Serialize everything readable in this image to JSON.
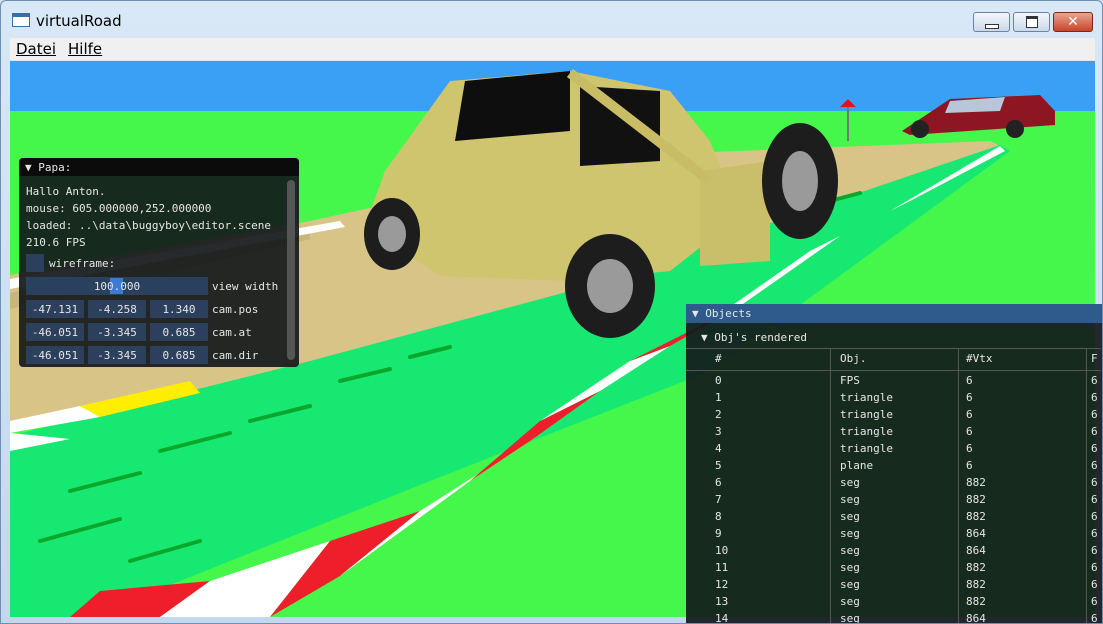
{
  "window": {
    "title": "virtualRoad",
    "minimize_icon": "minimize-icon",
    "maximize_icon": "maximize-icon",
    "close_icon": "close-icon",
    "close_glyph": "✕"
  },
  "menu": {
    "items": [
      "Datei",
      "Hilfe"
    ]
  },
  "papa": {
    "title": "▼ Papa:",
    "greeting": "Hallo Anton.",
    "mouse": "mouse: 605.000000,252.000000",
    "loaded": "loaded: ..\\data\\buggyboy\\editor.scene",
    "fps": "210.6 FPS",
    "wireframe_label": "wireframe:",
    "view_width_value": "100.000",
    "view_width_label": "view width",
    "cam_pos": [
      "-47.131",
      "-4.258",
      "1.340"
    ],
    "cam_pos_label": "cam.pos",
    "cam_at": [
      "-46.051",
      "-3.345",
      "0.685"
    ],
    "cam_at_label": "cam.at",
    "cam_dir": [
      "-46.051",
      "-3.345",
      "0.685"
    ],
    "cam_dir_label": "cam.dir"
  },
  "objects": {
    "title": "▼ Objects",
    "subheader": "▼ Obj's rendered",
    "columns": [
      "#",
      "Obj.",
      "#Vtx",
      "F"
    ],
    "rows": [
      [
        "0",
        "FPS",
        "6",
        "6"
      ],
      [
        "1",
        "triangle",
        "6",
        "6"
      ],
      [
        "2",
        "triangle",
        "6",
        "6"
      ],
      [
        "3",
        "triangle",
        "6",
        "6"
      ],
      [
        "4",
        "triangle",
        "6",
        "6"
      ],
      [
        "5",
        "plane",
        "6",
        "6"
      ],
      [
        "6",
        "seg",
        "882",
        "6"
      ],
      [
        "7",
        "seg",
        "882",
        "6"
      ],
      [
        "8",
        "seg",
        "882",
        "6"
      ],
      [
        "9",
        "seg",
        "864",
        "6"
      ],
      [
        "10",
        "seg",
        "864",
        "6"
      ],
      [
        "11",
        "seg",
        "882",
        "6"
      ],
      [
        "12",
        "seg",
        "882",
        "6"
      ],
      [
        "13",
        "seg",
        "882",
        "6"
      ],
      [
        "14",
        "seg",
        "864",
        "6"
      ]
    ]
  }
}
